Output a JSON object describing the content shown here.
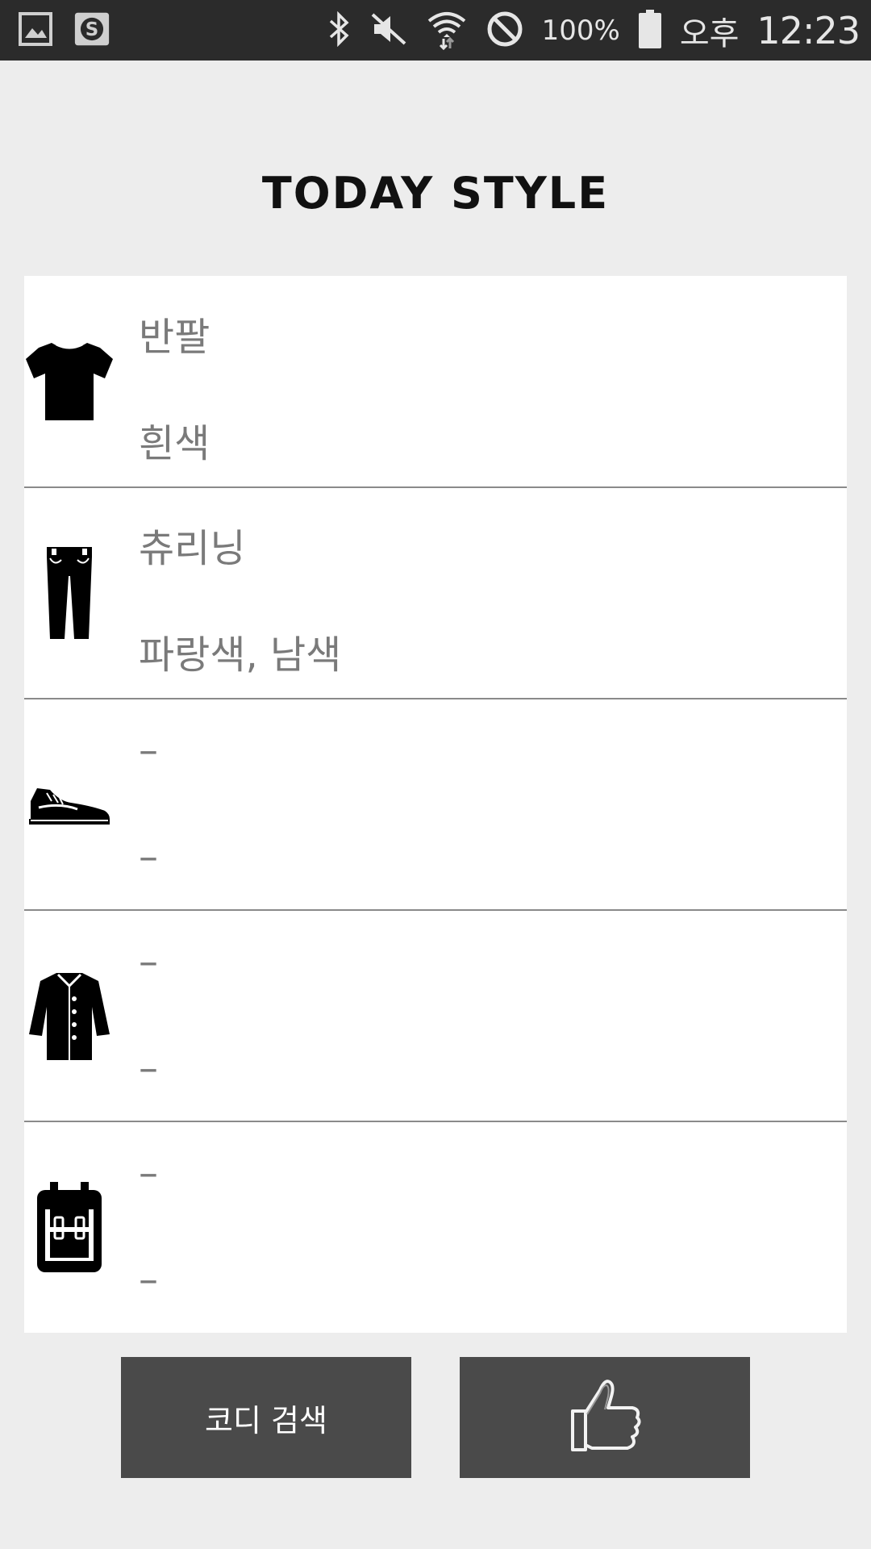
{
  "status_bar": {
    "icons_left": [
      "gallery-icon",
      "s-app-icon"
    ],
    "icons_right": [
      "bluetooth-icon",
      "mute-icon",
      "wifi-icon",
      "block-icon",
      "battery-icon"
    ],
    "battery": "100%",
    "ampm": "오후",
    "time": "12:23"
  },
  "title": "TODAY STYLE",
  "items": [
    {
      "icon": "tshirt-icon",
      "name": "반팔",
      "color": "흰색"
    },
    {
      "icon": "pants-icon",
      "name": "츄리닝",
      "color": "파랑색, 남색"
    },
    {
      "icon": "sneaker-icon",
      "name": "–",
      "color": "–"
    },
    {
      "icon": "coat-icon",
      "name": "–",
      "color": "–"
    },
    {
      "icon": "backpack-icon",
      "name": "–",
      "color": "–"
    }
  ],
  "buttons": {
    "search_label": "코디 검색",
    "like_icon": "thumbs-up-icon"
  },
  "colors": {
    "status_bar": "#2b2b2b",
    "background": "#ededed",
    "button": "#4a4a4a"
  }
}
